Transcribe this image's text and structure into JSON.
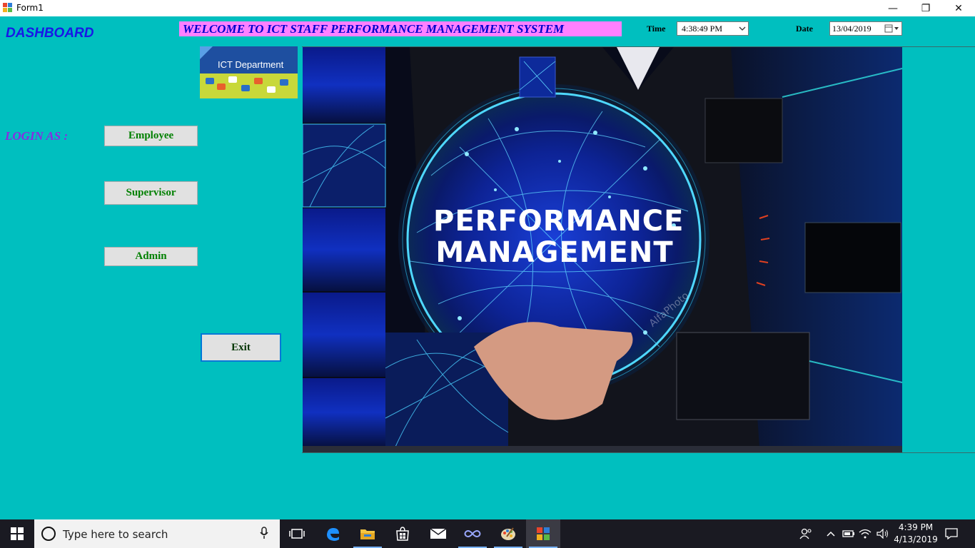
{
  "window": {
    "title": "Form1",
    "minimize_glyph": "—",
    "restore_glyph": "❐",
    "close_glyph": "✕"
  },
  "header": {
    "dashboard_label": "DASHBOARD",
    "welcome_banner": "WELCOME TO ICT STAFF PERFORMANCE MANAGEMENT SYSTEM",
    "time_label": "Time",
    "time_value": "4:38:49 PM",
    "date_label": "Date",
    "date_value": "13/04/2019"
  },
  "logo": {
    "text": "ICT Department"
  },
  "login": {
    "label": "LOGIN AS :",
    "employee_label": "Employee",
    "supervisor_label": "Supervisor",
    "admin_label": "Admin",
    "exit_label": "Exit"
  },
  "banner_image": {
    "line1": "PERFORMANCE",
    "line2": "MANAGEMENT",
    "watermark": "AlfaPhoto"
  },
  "taskbar": {
    "search_placeholder": "Type here to search",
    "clock_time": "4:39 PM",
    "clock_date": "4/13/2019"
  },
  "colors": {
    "form_background": "#00BFBF",
    "dashboard_text": "#1818E6",
    "welcome_background": "#FF80FF",
    "welcome_text": "#0000CD",
    "login_label": "#8A2BE2",
    "button_text": "#008000"
  },
  "icons": {
    "start": "windows-logo-icon",
    "search": "cortana-circle-icon",
    "mic": "microphone-icon",
    "task_view": "task-view-icon",
    "edge": "edge-browser-icon",
    "explorer": "file-explorer-icon",
    "store": "store-icon",
    "mail": "mail-icon",
    "link": "infinity-link-icon",
    "paint": "paint-palette-icon",
    "app": "winforms-app-icon",
    "people": "people-icon",
    "chevron": "chevron-up-icon",
    "battery": "battery-icon",
    "wifi": "wifi-icon",
    "volume": "volume-icon",
    "notifications": "action-center-icon"
  }
}
